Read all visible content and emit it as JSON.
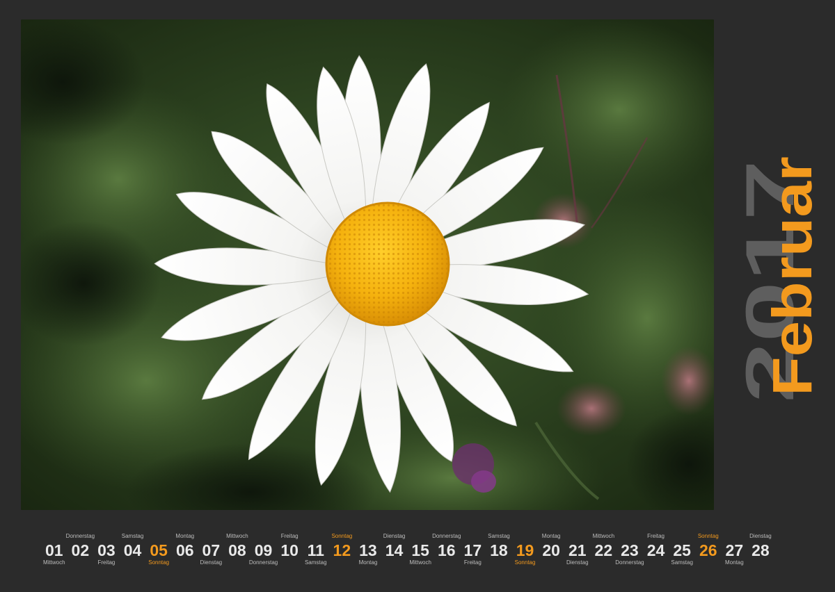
{
  "calendar": {
    "month": "Februar",
    "year": "2017",
    "accent_color": "#f39a1e",
    "year_color": "#5e5e5e",
    "background_color": "#2b2b2b"
  },
  "photo": {
    "subject_icon": "daisy-flower-photo"
  },
  "days": [
    {
      "num": "01",
      "weekday": "Mittwoch",
      "pos": "below",
      "sunday": false
    },
    {
      "num": "02",
      "weekday": "Donnerstag",
      "pos": "above",
      "sunday": false
    },
    {
      "num": "03",
      "weekday": "Freitag",
      "pos": "below",
      "sunday": false
    },
    {
      "num": "04",
      "weekday": "Samstag",
      "pos": "above",
      "sunday": false
    },
    {
      "num": "05",
      "weekday": "Sonntag",
      "pos": "below",
      "sunday": true
    },
    {
      "num": "06",
      "weekday": "Montag",
      "pos": "above",
      "sunday": false
    },
    {
      "num": "07",
      "weekday": "Dienstag",
      "pos": "below",
      "sunday": false
    },
    {
      "num": "08",
      "weekday": "Mittwoch",
      "pos": "above",
      "sunday": false
    },
    {
      "num": "09",
      "weekday": "Donnerstag",
      "pos": "below",
      "sunday": false
    },
    {
      "num": "10",
      "weekday": "Freitag",
      "pos": "above",
      "sunday": false
    },
    {
      "num": "11",
      "weekday": "Samstag",
      "pos": "below",
      "sunday": false
    },
    {
      "num": "12",
      "weekday": "Sonntag",
      "pos": "above",
      "sunday": true
    },
    {
      "num": "13",
      "weekday": "Montag",
      "pos": "below",
      "sunday": false
    },
    {
      "num": "14",
      "weekday": "Dienstag",
      "pos": "above",
      "sunday": false
    },
    {
      "num": "15",
      "weekday": "Mittwoch",
      "pos": "below",
      "sunday": false
    },
    {
      "num": "16",
      "weekday": "Donnerstag",
      "pos": "above",
      "sunday": false
    },
    {
      "num": "17",
      "weekday": "Freitag",
      "pos": "below",
      "sunday": false
    },
    {
      "num": "18",
      "weekday": "Samstag",
      "pos": "above",
      "sunday": false
    },
    {
      "num": "19",
      "weekday": "Sonntag",
      "pos": "below",
      "sunday": true
    },
    {
      "num": "20",
      "weekday": "Montag",
      "pos": "above",
      "sunday": false
    },
    {
      "num": "21",
      "weekday": "Dienstag",
      "pos": "below",
      "sunday": false
    },
    {
      "num": "22",
      "weekday": "Mittwoch",
      "pos": "above",
      "sunday": false
    },
    {
      "num": "23",
      "weekday": "Donnerstag",
      "pos": "below",
      "sunday": false
    },
    {
      "num": "24",
      "weekday": "Freitag",
      "pos": "above",
      "sunday": false
    },
    {
      "num": "25",
      "weekday": "Samstag",
      "pos": "below",
      "sunday": false
    },
    {
      "num": "26",
      "weekday": "Sonntag",
      "pos": "above",
      "sunday": true
    },
    {
      "num": "27",
      "weekday": "Montag",
      "pos": "below",
      "sunday": false
    },
    {
      "num": "28",
      "weekday": "Dienstag",
      "pos": "above",
      "sunday": false
    }
  ]
}
